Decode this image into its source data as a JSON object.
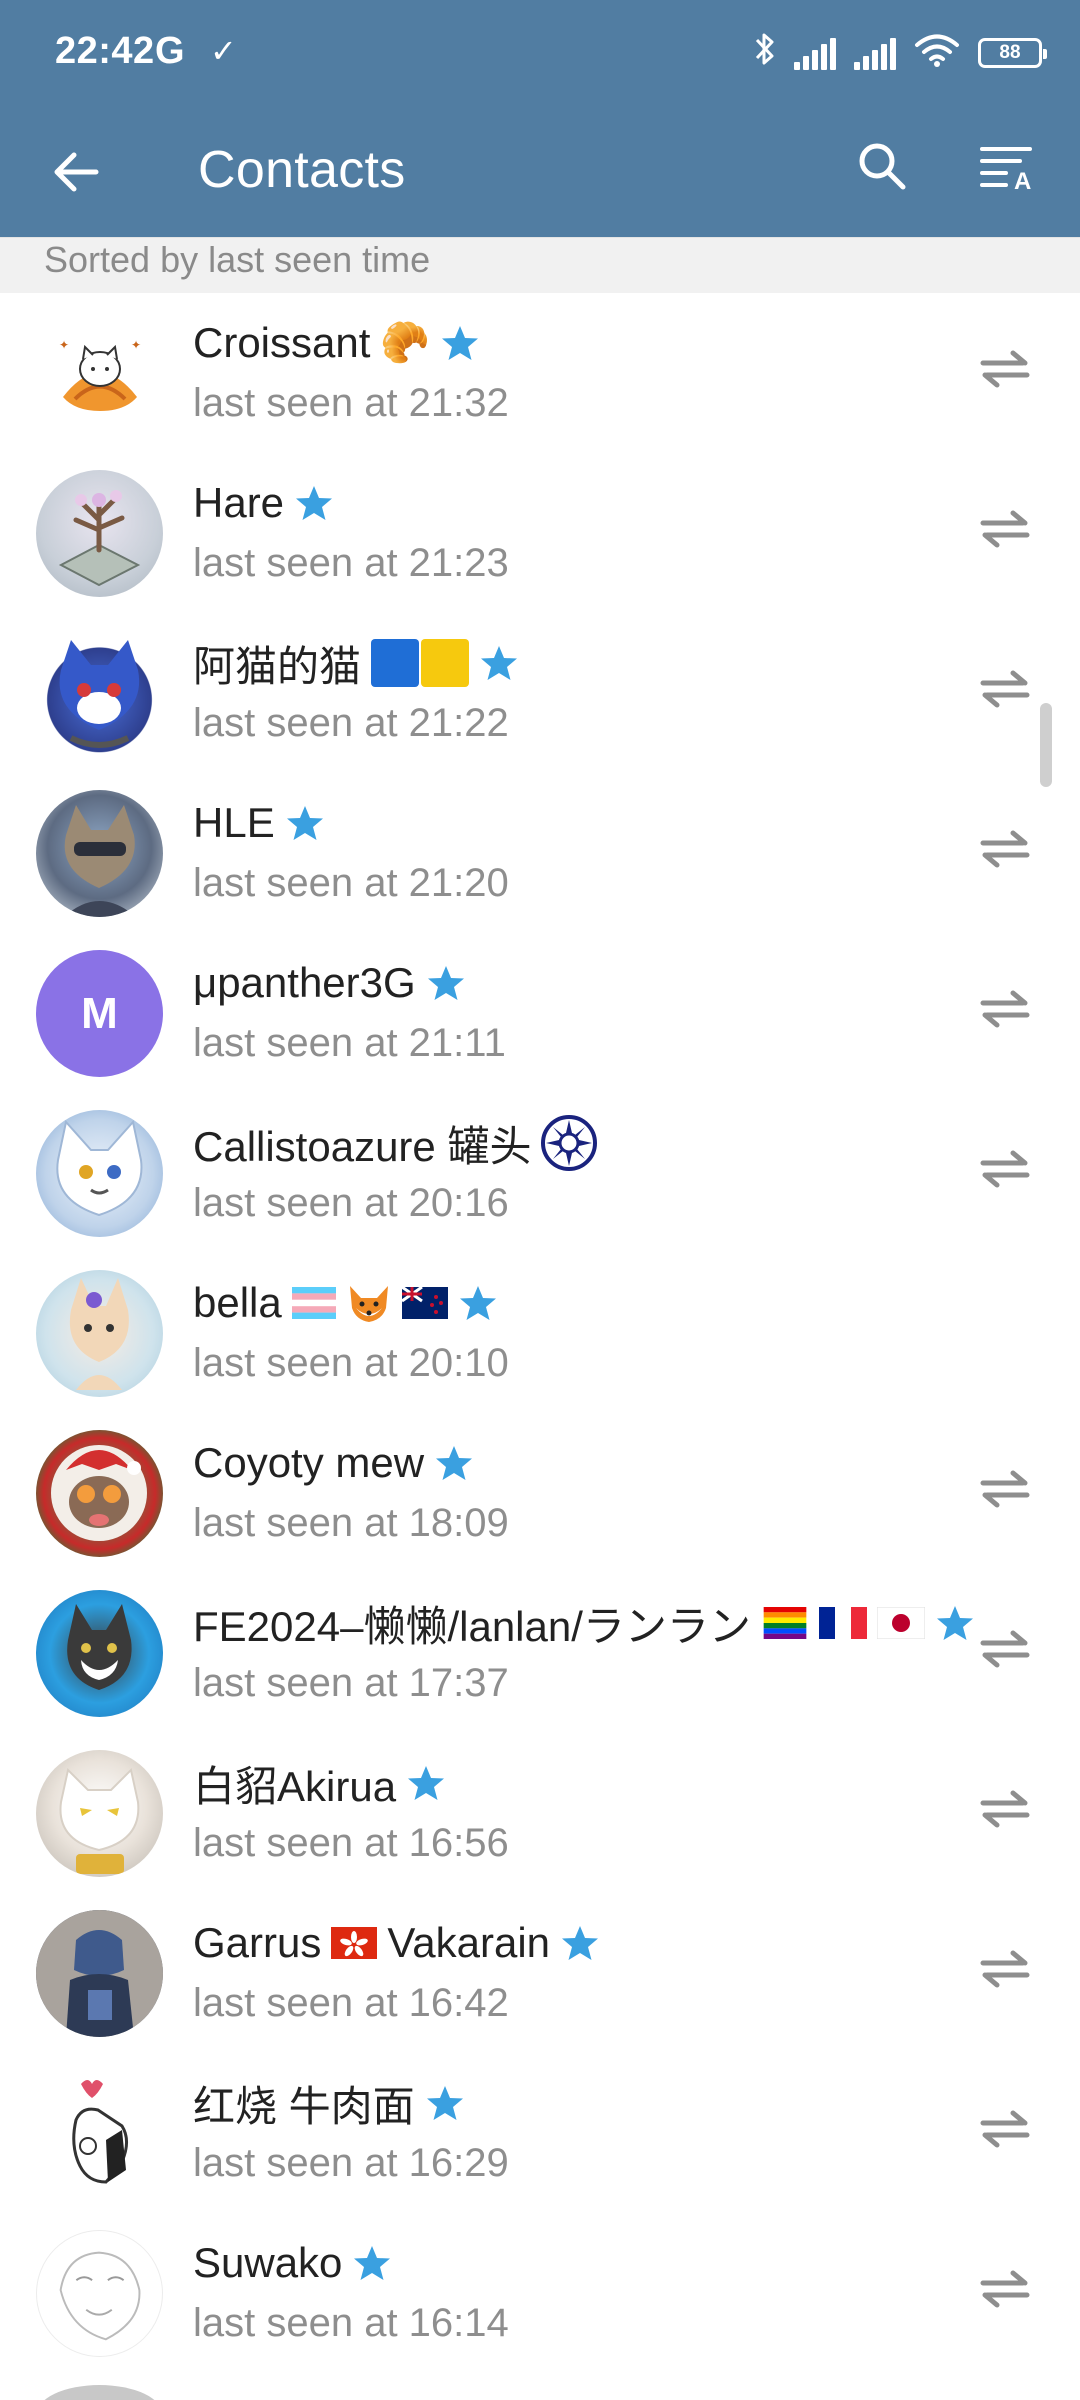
{
  "status_bar": {
    "time": "22:42",
    "network": "G",
    "notification_icon": "check-icon",
    "battery": "88",
    "icons": [
      "bluetooth-icon",
      "signal-icon",
      "signal-icon",
      "wifi-icon",
      "battery-icon"
    ]
  },
  "toolbar": {
    "title": "Contacts",
    "back_icon": "back-arrow-icon",
    "search_icon": "search-icon",
    "sort_icon": "sort-alpha-icon"
  },
  "section": {
    "label": "Sorted by last seen time"
  },
  "colors": {
    "header": "#517da2",
    "star": "#3aa0e0",
    "secondary_text": "#8e8e8e",
    "avatar_m": "#8a72e6"
  },
  "contacts": [
    {
      "name": "Croissant",
      "emojis_after": [
        "🥐"
      ],
      "star": true,
      "last_seen": "last seen at 21:32",
      "swap": true
    },
    {
      "name": "Hare",
      "emojis_after": [],
      "star": true,
      "last_seen": "last seen at 21:23",
      "swap": true
    },
    {
      "name": "阿猫的猫",
      "emojis_after": [
        "🟦",
        "🟨"
      ],
      "star": true,
      "last_seen": "last seen at 21:22",
      "swap": true
    },
    {
      "name": "HLE",
      "emojis_after": [],
      "star": true,
      "last_seen": "last seen at 21:20",
      "swap": true
    },
    {
      "name": "μpanther3G",
      "emojis_after": [],
      "star": true,
      "last_seen": "last seen at 21:11",
      "swap": true,
      "avatar_letter": "M"
    },
    {
      "name": "Callistoazure 罐头",
      "emojis_after": [
        "☀"
      ],
      "star": false,
      "last_seen": "last seen at 20:16",
      "swap": true
    },
    {
      "name": "bella",
      "emojis_after": [
        "🏳️‍⚧️",
        "🦊",
        "🇳🇿"
      ],
      "star": true,
      "last_seen": "last seen at 20:10",
      "swap": false
    },
    {
      "name": "Coyoty mew",
      "emojis_after": [],
      "star": true,
      "last_seen": "last seen at 18:09",
      "swap": true
    },
    {
      "name": "FE2024–懒懒/lanlan/ランラン",
      "emojis_after": [
        "🏳️‍🌈",
        "🇫🇷",
        "🇯🇵"
      ],
      "star": true,
      "last_seen": "last seen at 17:37",
      "swap": true
    },
    {
      "name": "白貂Akirua",
      "emojis_after": [],
      "star": true,
      "last_seen": "last seen at 16:56",
      "swap": true
    },
    {
      "name": "Garrus",
      "emojis_after": [
        "🇭🇰"
      ],
      "name_suffix": "Vakarain",
      "star": true,
      "last_seen": "last seen at 16:42",
      "swap": true
    },
    {
      "name": "红烧 牛肉面",
      "emojis_after": [],
      "star": true,
      "last_seen": "last seen at 16:29",
      "swap": true
    },
    {
      "name": "Suwako",
      "emojis_after": [],
      "star": true,
      "last_seen": "last seen at 16:14",
      "swap": true
    }
  ]
}
